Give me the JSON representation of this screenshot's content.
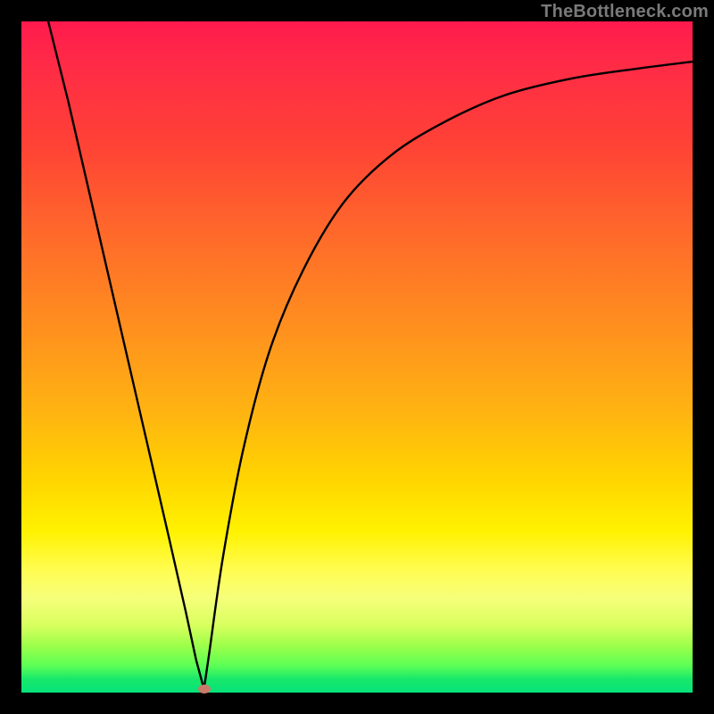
{
  "watermark": "TheBottleneck.com",
  "colors": {
    "background": "#000000",
    "curve_stroke": "#000000",
    "marker_fill": "#c97a6a",
    "gradient_stops": [
      "#ff1a4d",
      "#ff4136",
      "#ff6a2a",
      "#ff8e1f",
      "#ffb312",
      "#ffd400",
      "#fff200",
      "#fffd55",
      "#d8ff5e",
      "#5cff55",
      "#06e27b"
    ]
  },
  "chart_data": {
    "type": "line",
    "title": "",
    "xlabel": "",
    "ylabel": "",
    "xlim": [
      0,
      100
    ],
    "ylim": [
      0,
      100
    ],
    "grid": false,
    "legend": false,
    "series": [
      {
        "name": "left-segment",
        "x": [
          4,
          7,
          10,
          13,
          16,
          19,
          22,
          24.5,
          26,
          27.2
        ],
        "y": [
          100,
          88,
          75,
          62,
          49,
          36,
          23,
          12,
          5,
          0.5
        ]
      },
      {
        "name": "right-segment",
        "x": [
          27.2,
          28,
          30,
          33,
          37,
          42,
          48,
          55,
          63,
          72,
          82,
          92,
          100
        ],
        "y": [
          0.5,
          6,
          20,
          36,
          51,
          63,
          73,
          80,
          85,
          89,
          91.5,
          93,
          94
        ]
      }
    ],
    "annotations": [
      {
        "name": "min-marker",
        "x": 27.2,
        "y": 0.5
      }
    ]
  }
}
